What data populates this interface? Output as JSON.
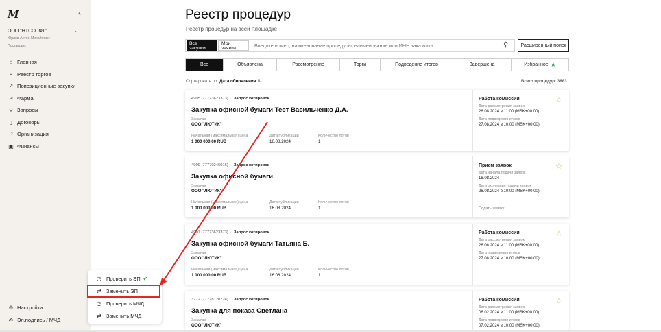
{
  "sidebar": {
    "logo": "M",
    "collapse_icon": "chevron-left-icon",
    "org": "ООО \"НТССОФТ\"",
    "user_name": "Юрлов Антон Михайлович",
    "user_role": "Поставщик",
    "items": [
      {
        "label": "Главная",
        "icon": "home-icon"
      },
      {
        "label": "Реестр торгов",
        "icon": "list-icon"
      },
      {
        "label": "Попозиционные закупки",
        "icon": "arrow-icon"
      },
      {
        "label": "Фарма",
        "icon": "arrow-icon"
      },
      {
        "label": "Запросы",
        "icon": "search-icon"
      },
      {
        "label": "Договоры",
        "icon": "document-icon"
      },
      {
        "label": "Организация",
        "icon": "flag-icon"
      },
      {
        "label": "Финансы",
        "icon": "wallet-icon"
      }
    ],
    "bottom": [
      {
        "label": "Настройки",
        "icon": "gear-icon"
      },
      {
        "label": "Эл.подпись / МЧД",
        "icon": "signature-icon"
      }
    ]
  },
  "popup": {
    "items": [
      {
        "label": "Проверить ЭП",
        "icon": "clock-icon",
        "status": "check-icon"
      },
      {
        "label": "Заменить ЭП",
        "icon": "swap-icon"
      },
      {
        "label": "Проверить МЧД",
        "icon": "clock-icon"
      },
      {
        "label": "Заменить МЧД",
        "icon": "swap-icon"
      }
    ]
  },
  "header": {
    "title": "Реестр процедур",
    "subtitle": "Реестр процедур на всей площадке"
  },
  "search": {
    "toggle_all": "Все закупки",
    "toggle_mine": "Мои заявки",
    "placeholder": "Введите номер, наименование процедуры, наименование или ИНН заказчика",
    "advanced": "Расширенный поиск"
  },
  "tabs": [
    "Все",
    "Объявлена",
    "Рассмотрение",
    "Торги",
    "Подведение итогов",
    "Завершена",
    "Избранное"
  ],
  "sort": {
    "prefix": "Сортировать по:",
    "field": "Дата обновления"
  },
  "total": "Всего процедур: 3683",
  "labels": {
    "customer": "Заказчик",
    "price": "Начальная (максимальная) цена",
    "pub_date": "Дата публикации",
    "lots": "Количество лотов"
  },
  "cards": [
    {
      "number": "4905 (77773623373)",
      "type": "Запрос котировок",
      "title": "Закупка офисной бумаги Тест Васильченко Д.А.",
      "customer": "ООО \"ЛЮТИК\"",
      "price": "1 000 000,00 RUB",
      "pub_date": "16.08.2024",
      "lots": "1",
      "status": "Работа комиссии",
      "s1_label": "Дата рассмотрения заявок",
      "s1_value": "26.08.2024 в 11:00 (MSK+00:00)",
      "s2_label": "Дата подведения итогов",
      "s2_value": "27.08.2024 в 10:00 (MSK+00:00)"
    },
    {
      "number": "4909 (77770246016)",
      "type": "Запрос котировок",
      "title": "Закупка офисной бумаги",
      "customer": "ООО \"ЛЮТИК\"",
      "price": "1 000 000,00 RUB",
      "pub_date": "16.08.2024",
      "lots": "1",
      "status": "Прием заявок",
      "s1_label": "Дата начала подачи заявок",
      "s1_value": "16.08.2024",
      "s2_label": "Дата окончания подачи заявок",
      "s2_value": "26.08.2024 в 10:00 (MSK+00:00)",
      "action": "Подать заявку"
    },
    {
      "number": "4907 (77773623373)",
      "type": "Запрос котировок",
      "title": "Закупка офисной бумаги Татьяна Б.",
      "customer": "ООО \"ЛЮТИК\"",
      "price": "1 000 000,00 RUB",
      "pub_date": "16.08.2024",
      "lots": "1",
      "status": "Работа комиссии",
      "s1_label": "Дата рассмотрения заявок",
      "s1_value": "26.08.2024 в 11:00 (MSK+00:00)",
      "s2_label": "Дата подведения итогов",
      "s2_value": "27.08.2024 в 10:00 (MSK+00:00)"
    },
    {
      "number": "3772 (77778120724)",
      "type": "Запрос котировок",
      "title": "Закупка для показа Светлана",
      "customer": "ООО \"ЛЮТИК\"",
      "status": "Работа комиссии",
      "s1_label": "Дата рассмотрения заявок",
      "s1_value": "06.02.2024 в 11:00 (MSK+00:00)",
      "s2_label": "Дата подведения итогов",
      "s2_value": "07.02.2024 в 10:00 (MSK+00:00)"
    }
  ],
  "colors": {
    "highlight": "#e3261f",
    "accent_green": "#3aa34a",
    "fav_star": "#b9bd55"
  }
}
